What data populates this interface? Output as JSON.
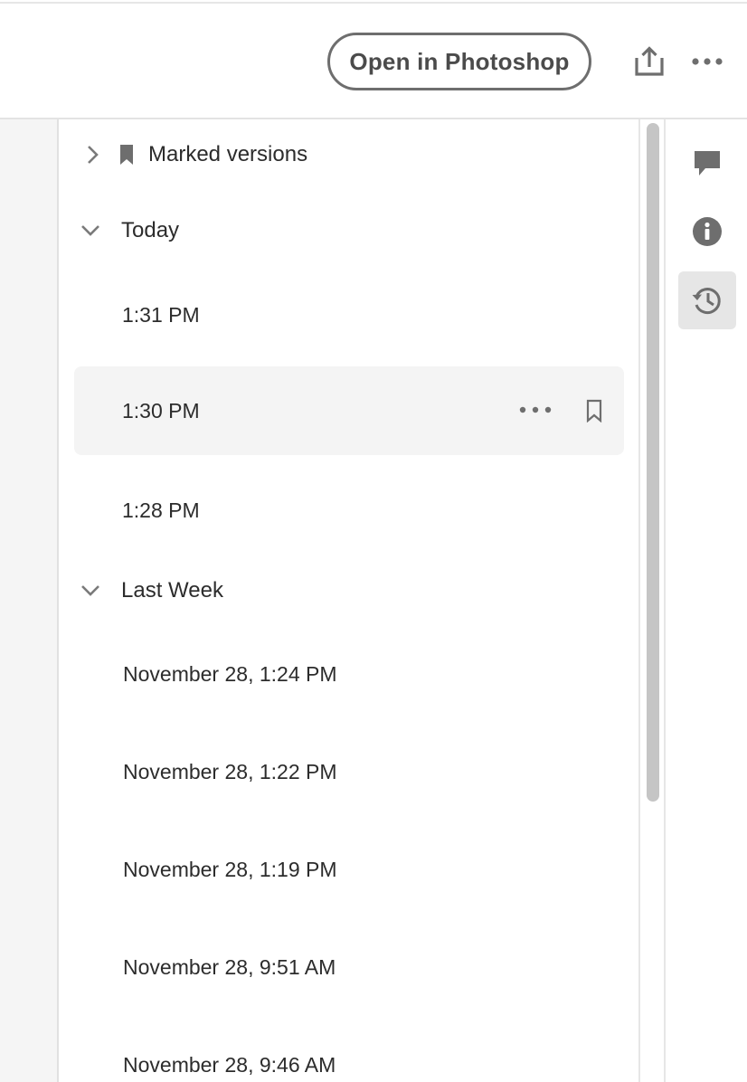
{
  "header": {
    "open_button_label": "Open in Photoshop",
    "share_icon": "share-icon",
    "more_icon": "more-horizontal-icon"
  },
  "rail": {
    "items": [
      {
        "name": "comments",
        "icon": "comment-icon",
        "active": false
      },
      {
        "name": "info",
        "icon": "info-icon",
        "active": false
      },
      {
        "name": "version-history",
        "icon": "history-icon",
        "active": true
      }
    ]
  },
  "versions": {
    "marked": {
      "label": "Marked versions",
      "expanded": false
    },
    "groups": [
      {
        "label": "Today",
        "expanded": true,
        "items": [
          {
            "label": "1:31 PM"
          },
          {
            "label": "1:30 PM",
            "hovered": true
          },
          {
            "label": "1:28 PM"
          }
        ]
      },
      {
        "label": "Last Week",
        "expanded": true,
        "items": [
          {
            "label": "November 28, 1:24 PM"
          },
          {
            "label": "November 28, 1:22 PM"
          },
          {
            "label": "November 28, 1:19 PM"
          },
          {
            "label": "November 28, 9:51 AM"
          },
          {
            "label": "November 28, 9:46 AM"
          }
        ]
      }
    ]
  },
  "colors": {
    "icon_gray": "#6e6e6e",
    "hover_row": "#f4f4f4",
    "active_rail": "#e6e6e6",
    "scroll_thumb": "#c5c5c5"
  }
}
